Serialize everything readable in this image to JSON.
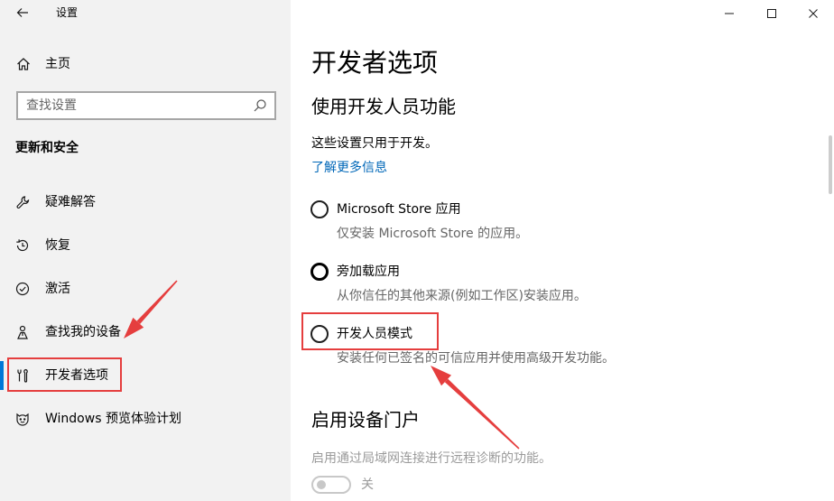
{
  "window": {
    "title": "设置",
    "controls": [
      "minimize-icon",
      "maximize-icon",
      "close-icon"
    ]
  },
  "sidebar": {
    "home_label": "主页",
    "search_placeholder": "查找设置",
    "section_title": "更新和安全",
    "items": [
      {
        "label": "疑难解答",
        "icon": "wrench-icon"
      },
      {
        "label": "恢复",
        "icon": "history-icon"
      },
      {
        "label": "激活",
        "icon": "check-circle-icon"
      },
      {
        "label": "查找我的设备",
        "icon": "find-device-icon"
      },
      {
        "label": "开发者选项",
        "icon": "developer-tools-icon",
        "selected": true
      },
      {
        "label": "Windows 预览体验计划",
        "icon": "insider-icon"
      }
    ]
  },
  "main": {
    "page_title": "开发者选项",
    "section1": {
      "title": "使用开发人员功能",
      "description": "这些设置只用于开发。",
      "link": "了解更多信息",
      "options": [
        {
          "label": "Microsoft Store 应用",
          "description": "仅安装 Microsoft Store 的应用。"
        },
        {
          "label": "旁加载应用",
          "description": "从你信任的其他来源(例如工作区)安装应用。"
        },
        {
          "label": "开发人员模式",
          "description": "安装任何已签名的可信应用并使用高级开发功能。"
        }
      ]
    },
    "section2": {
      "title": "启用设备门户",
      "description": "启用通过局域网连接进行远程诊断的功能。",
      "toggle": {
        "on": false,
        "state_label": "关"
      }
    }
  },
  "colors": {
    "accent": "#0078d7",
    "link": "#0067b8",
    "annotation": "#e53e3e"
  }
}
